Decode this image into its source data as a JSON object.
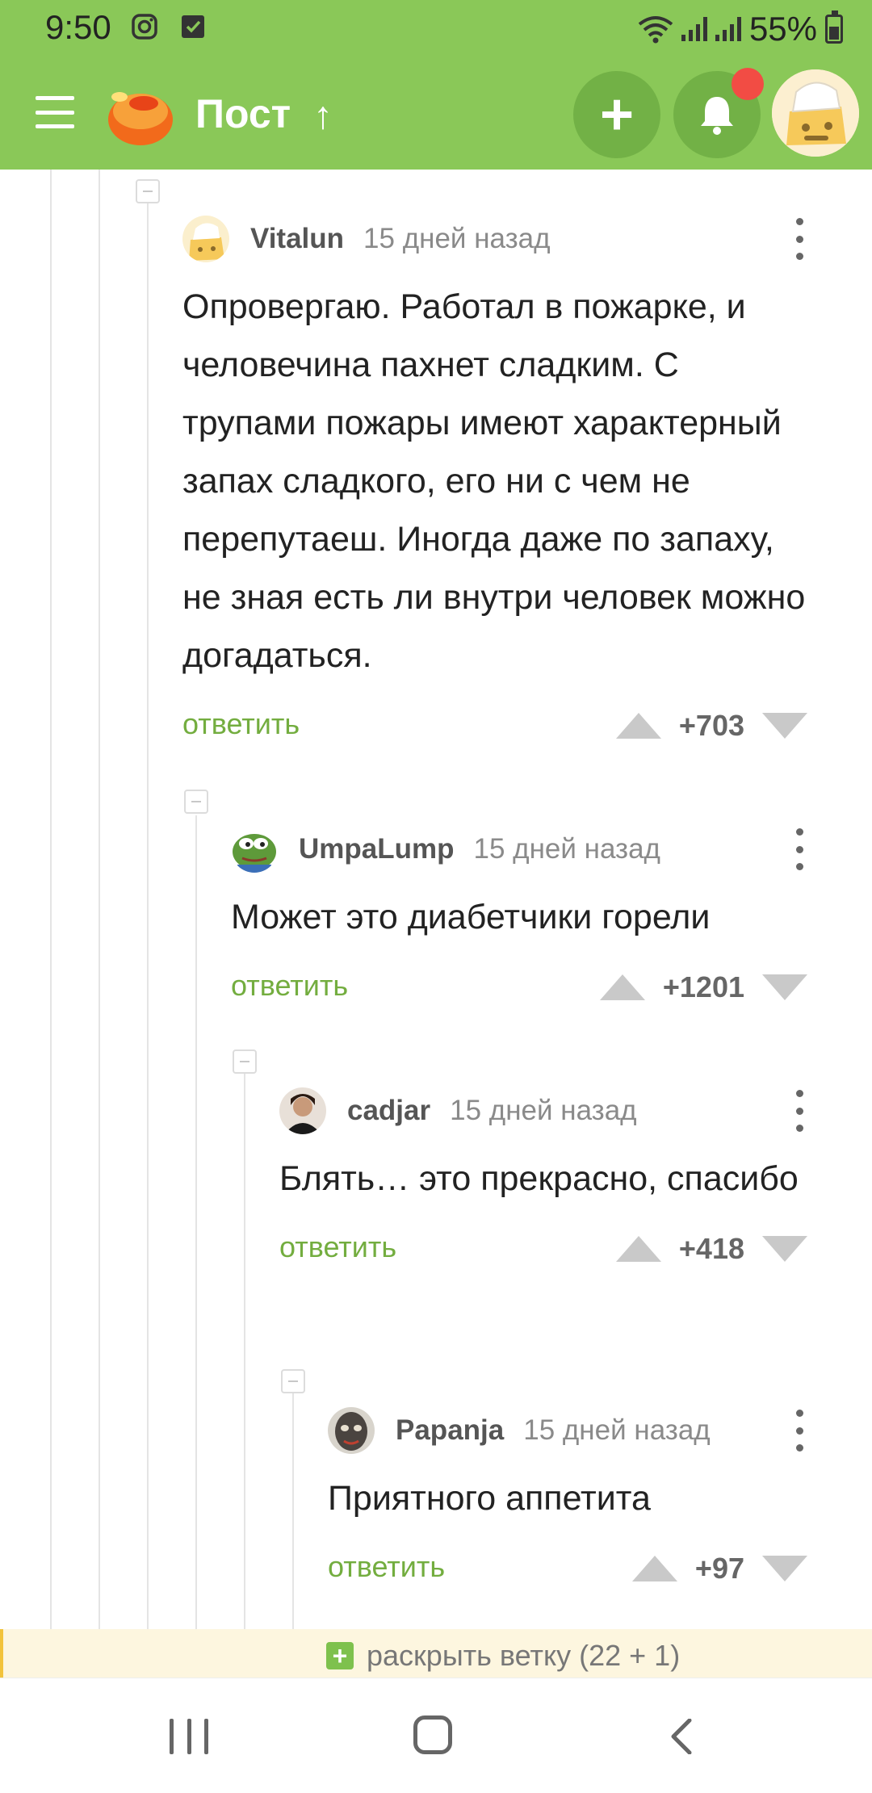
{
  "status_bar": {
    "time": "9:50",
    "battery": "55%",
    "icons": [
      "instagram-icon",
      "checkbox-icon",
      "wifi-icon",
      "signal-icon",
      "signal-icon",
      "battery-icon"
    ]
  },
  "app_bar": {
    "title": "Пост",
    "title_arrow": "↑",
    "add_label": "+",
    "accent_color": "#8ac858",
    "icons": [
      "menu-icon",
      "logo-icon",
      "plus-icon",
      "bell-icon",
      "avatar"
    ]
  },
  "comments": [
    {
      "author": "Vitalun",
      "time": "15 дней назад",
      "text": "Опровергаю. Работал в пожарке, и человечина пахнет сладким. С трупами пожары имеют характерный запах сладкого, его ни с чем не перепутаеш. Иногда даже по запаху, не зная есть ли внутри человек можно догадаться.",
      "reply_label": "ответить",
      "score": "+703"
    },
    {
      "author": "UmpaLump",
      "time": "15 дней назад",
      "text": "Может это диабетчики горели",
      "reply_label": "ответить",
      "score": "+1201"
    },
    {
      "author": "cadjar",
      "time": "15 дней назад",
      "text": "Блять… это прекрасно, спасибо",
      "reply_label": "ответить",
      "score": "+418"
    },
    {
      "author": "Papanja",
      "time": "15 дней назад",
      "text": "Приятного аппетита",
      "reply_label": "ответить",
      "score": "+97"
    }
  ],
  "expand_branch": {
    "plus": "+",
    "label": "раскрыть ветку (22 + 1)"
  },
  "nav_bar": {
    "icons": [
      "recent-apps-icon",
      "home-icon",
      "back-icon"
    ]
  }
}
